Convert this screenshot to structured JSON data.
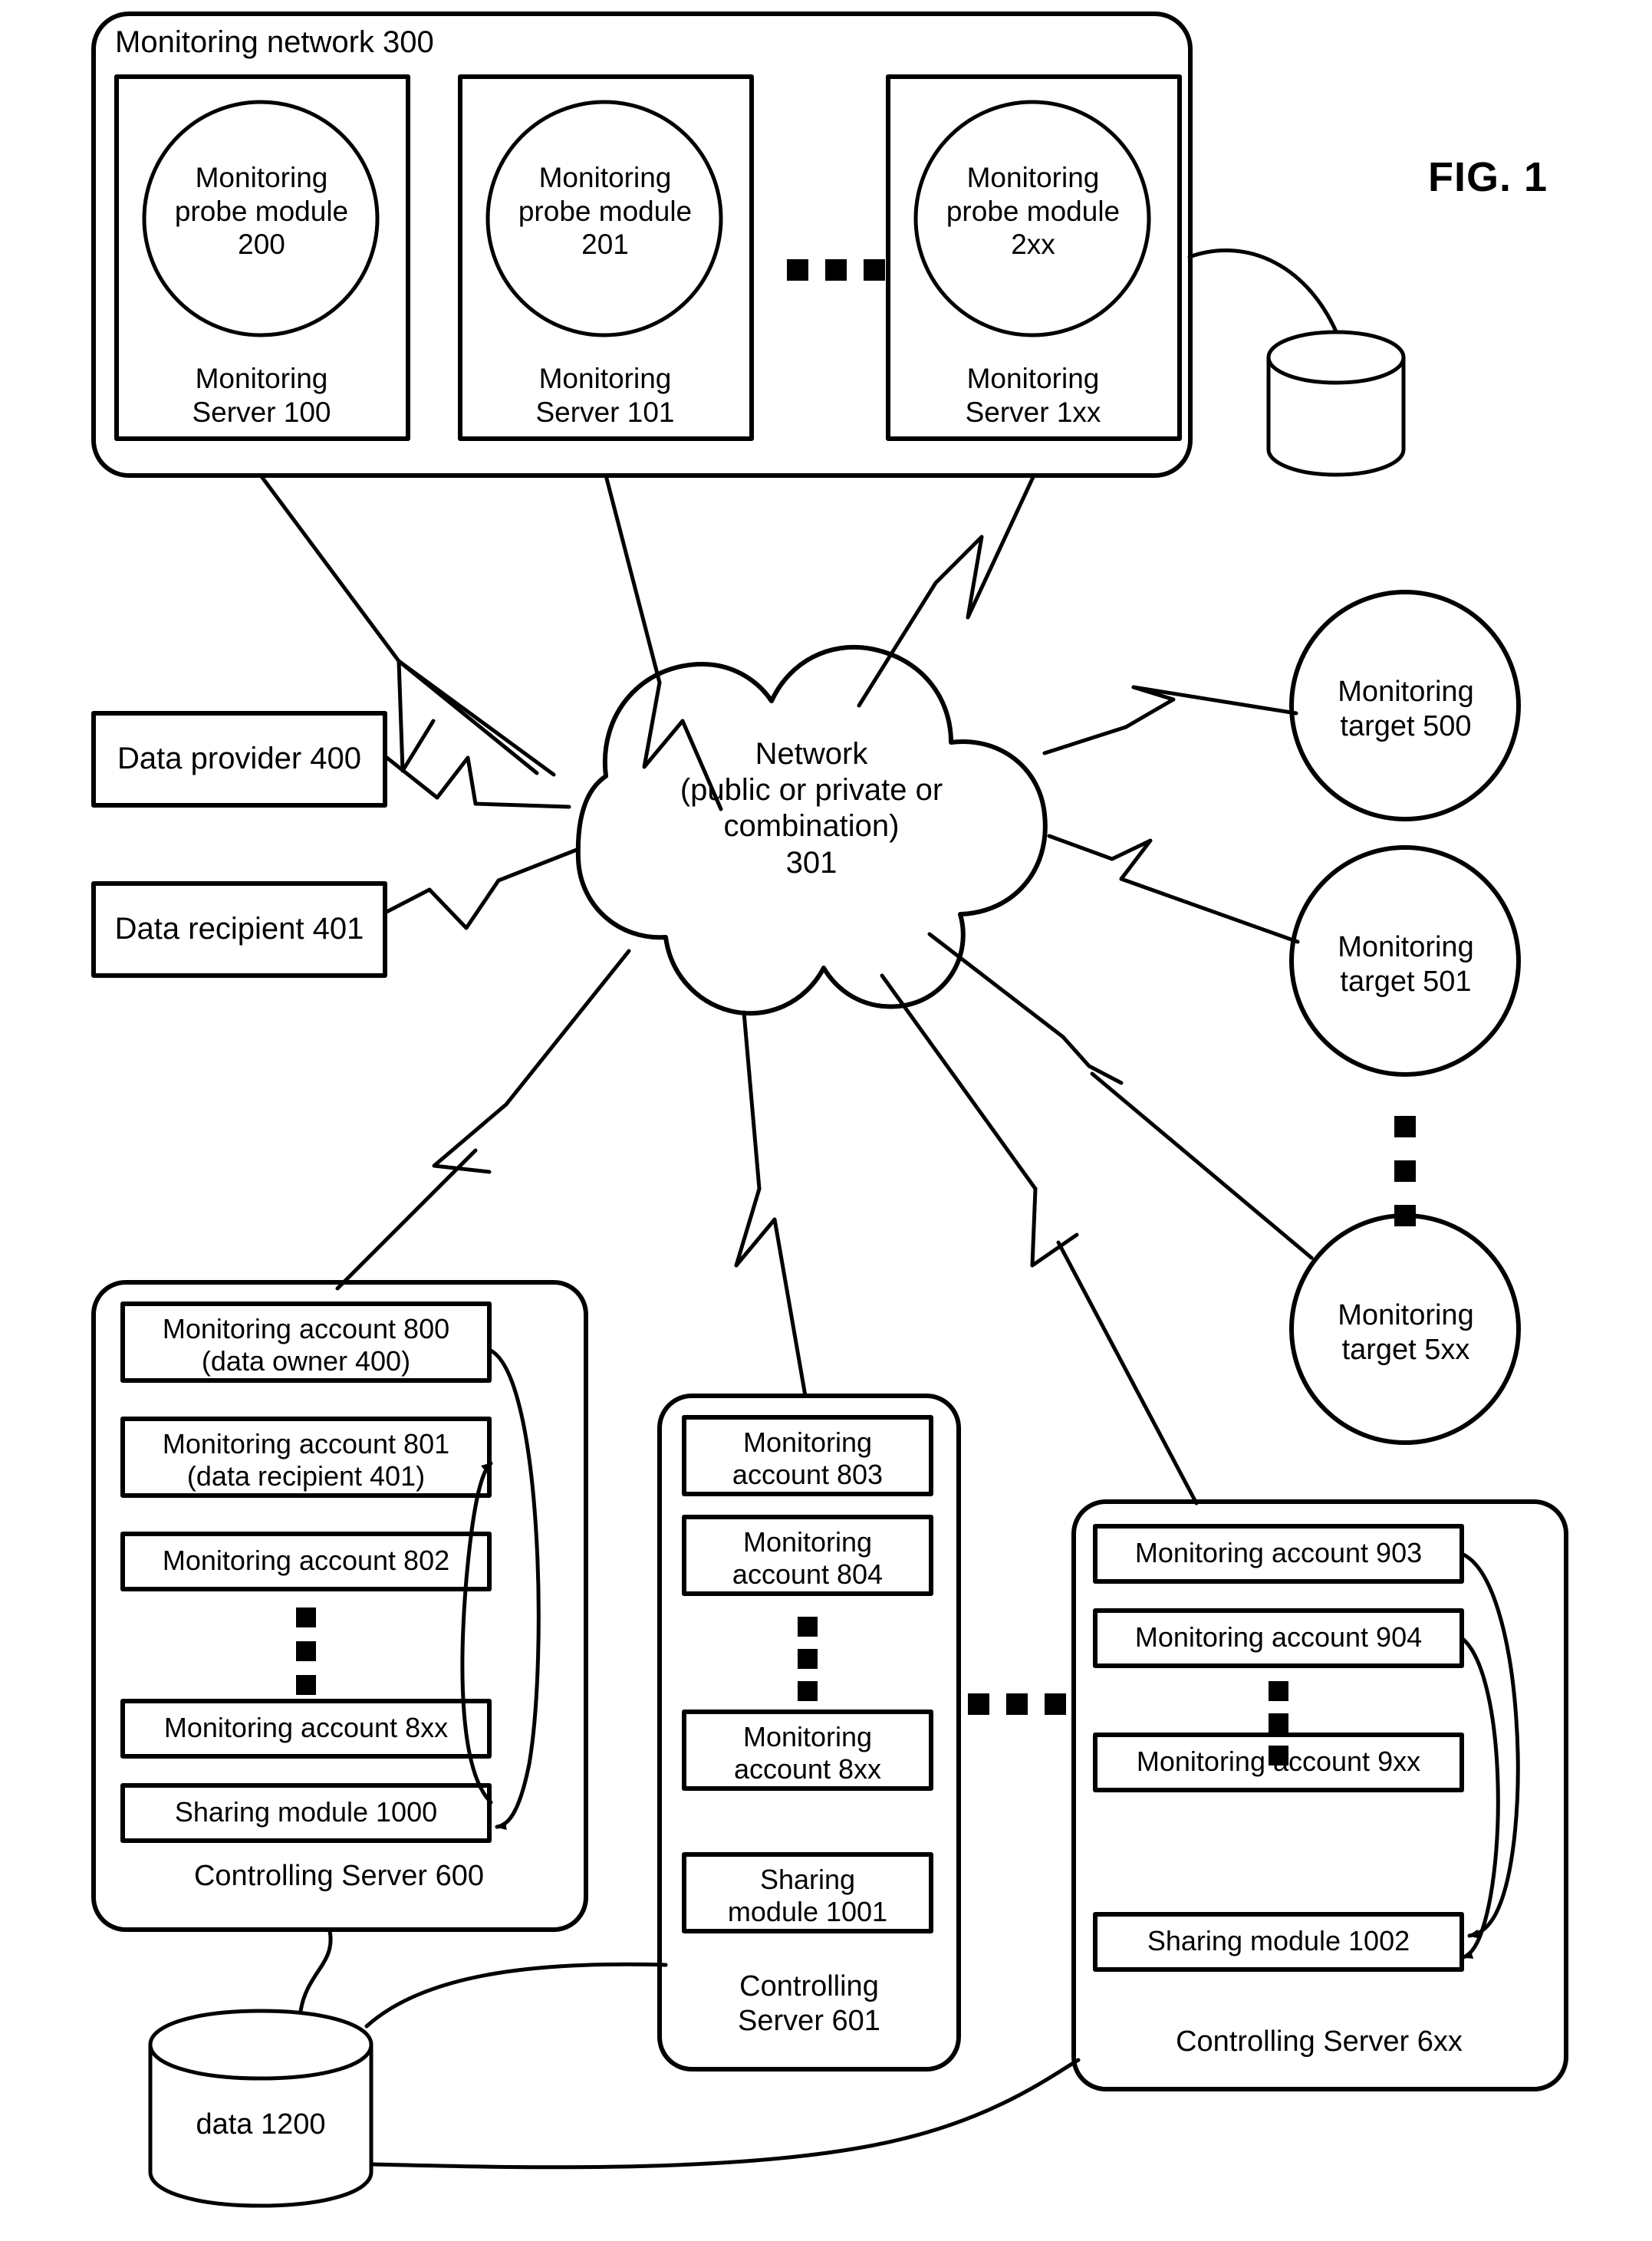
{
  "figure": {
    "label": "FIG. 1"
  },
  "monitoring_network": {
    "title": "Monitoring network 300",
    "servers": [
      {
        "probe": "Monitoring\nprobe module\n200",
        "probe_line1": "Monitoring",
        "probe_line2": "probe module",
        "probe_line3": "200",
        "server_line1": "Monitoring",
        "server_line2": "Server 100"
      },
      {
        "probe_line1": "Monitoring",
        "probe_line2": "probe module",
        "probe_line3": "201",
        "server_line1": "Monitoring",
        "server_line2": "Server 101"
      },
      {
        "probe_line1": "Monitoring",
        "probe_line2": "probe module",
        "probe_line3": "2xx",
        "server_line1": "Monitoring",
        "server_line2": "Server 1xx"
      }
    ],
    "ellipsis": "■ ■ ■"
  },
  "network_cloud": {
    "line1": "Network",
    "line2": "(public or private or",
    "line3": "combination)",
    "line4": "301"
  },
  "left_nodes": {
    "data_provider": "Data provider 400",
    "data_recipient": "Data recipient 401"
  },
  "monitoring_targets": [
    {
      "line1": "Monitoring",
      "line2": "target 500"
    },
    {
      "line1": "Monitoring",
      "line2": "target 501"
    },
    {
      "line1": "Monitoring",
      "line2": "target 5xx"
    }
  ],
  "controlling_server_600": {
    "footer": "Controlling Server 600",
    "accounts": [
      {
        "line1": "Monitoring account 800",
        "line2": "(data owner 400)"
      },
      {
        "line1": "Monitoring account 801",
        "line2": "(data recipient 401)"
      },
      {
        "line1": "Monitoring account 802",
        "line2": ""
      },
      {
        "line1": "Monitoring account 8xx",
        "line2": ""
      }
    ],
    "sharing_module": "Sharing module 1000"
  },
  "controlling_server_601": {
    "footer_line1": "Controlling",
    "footer_line2": "Server 601",
    "accounts": [
      {
        "line1": "Monitoring",
        "line2": "account 803"
      },
      {
        "line1": "Monitoring",
        "line2": "account 804"
      },
      {
        "line1": "Monitoring",
        "line2": "account 8xx"
      }
    ],
    "sharing_module_line1": "Sharing",
    "sharing_module_line2": "module 1001"
  },
  "controlling_server_6xx": {
    "footer": "Controlling Server 6xx",
    "accounts": [
      {
        "line1": "Monitoring account 903"
      },
      {
        "line1": "Monitoring account 904"
      },
      {
        "line1": "Monitoring account 9xx"
      }
    ],
    "sharing_module": "Sharing module 1002"
  },
  "database": {
    "label": "data 1200"
  },
  "colors": {
    "stroke": "#000000",
    "fill": "#ffffff"
  }
}
